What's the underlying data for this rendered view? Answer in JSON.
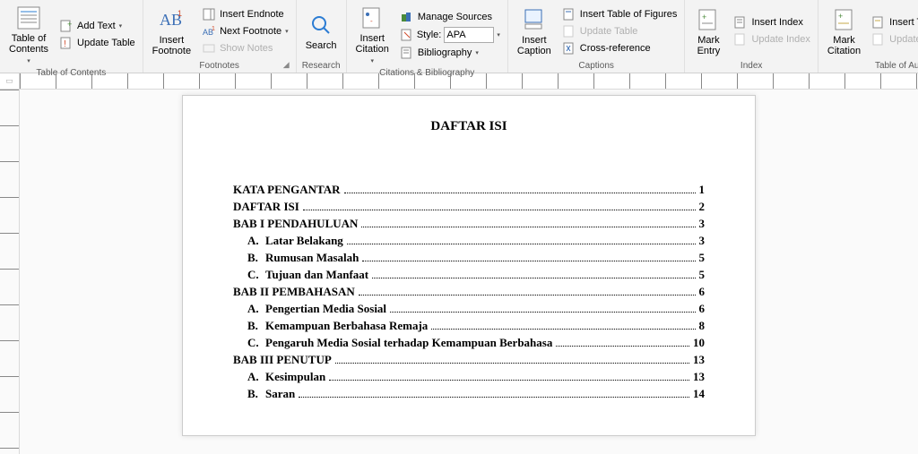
{
  "ribbon": {
    "groups": {
      "toc": {
        "label": "Table of Contents",
        "toc_btn": "Table of\nContents",
        "add_text": "Add Text",
        "update": "Update Table"
      },
      "footnotes": {
        "label": "Footnotes",
        "insert": "Insert\nFootnote",
        "endnote": "Insert Endnote",
        "next": "Next Footnote",
        "show": "Show Notes"
      },
      "research": {
        "label": "Research",
        "search": "Search"
      },
      "citations": {
        "label": "Citations & Bibliography",
        "insert": "Insert\nCitation",
        "manage": "Manage Sources",
        "style_label": "Style:",
        "style_value": "APA",
        "biblio": "Bibliography"
      },
      "captions": {
        "label": "Captions",
        "insert": "Insert\nCaption",
        "figures": "Insert Table of Figures",
        "update": "Update Table",
        "crossref": "Cross-reference"
      },
      "index": {
        "label": "Index",
        "mark": "Mark\nEntry",
        "insert": "Insert Index",
        "update": "Update Index"
      },
      "authorities": {
        "label": "Table of Authorities",
        "mark": "Mark\nCitation",
        "insert": "Insert Table of Authorities",
        "update": "Update Table"
      }
    }
  },
  "document": {
    "title": "DAFTAR ISI",
    "toc": [
      {
        "label": "KATA PENGANTAR",
        "page": "1",
        "sub": false
      },
      {
        "label": "DAFTAR ISI",
        "page": "2",
        "sub": false
      },
      {
        "label": "BAB I PENDAHULUAN",
        "page": "3",
        "sub": false
      },
      {
        "letter": "A.",
        "label": "Latar Belakang",
        "page": "3",
        "sub": true
      },
      {
        "letter": "B.",
        "label": "Rumusan Masalah",
        "page": "5",
        "sub": true
      },
      {
        "letter": "C.",
        "label": "Tujuan dan Manfaat",
        "page": "5",
        "sub": true
      },
      {
        "label": "BAB II PEMBAHASAN",
        "page": "6",
        "sub": false
      },
      {
        "letter": "A.",
        "label": "Pengertian Media Sosial",
        "page": "6",
        "sub": true
      },
      {
        "letter": "B.",
        "label": "Kemampuan Berbahasa Remaja",
        "page": "8",
        "sub": true
      },
      {
        "letter": "C.",
        "label": "Pengaruh Media Sosial terhadap Kemampuan Berbahasa",
        "page": "10",
        "sub": true
      },
      {
        "label": "BAB III PENUTUP",
        "page": "13",
        "sub": false
      },
      {
        "letter": "A.",
        "label": "Kesimpulan",
        "page": "13",
        "sub": true
      },
      {
        "letter": "B.",
        "label": "Saran",
        "page": "14",
        "sub": true
      }
    ]
  }
}
